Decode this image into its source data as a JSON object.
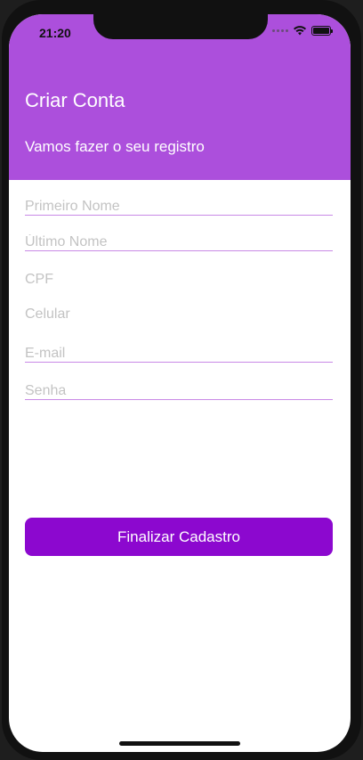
{
  "status_bar": {
    "time": "21:20"
  },
  "header": {
    "title": "Criar Conta",
    "subtitle": "Vamos fazer o seu registro"
  },
  "form": {
    "fields": [
      {
        "placeholder": "Primeiro Nome",
        "value": ""
      },
      {
        "placeholder": "Último Nome",
        "value": ""
      },
      {
        "placeholder": "CPF",
        "value": ""
      },
      {
        "placeholder": "Celular",
        "value": ""
      },
      {
        "placeholder": "E-mail",
        "value": ""
      },
      {
        "placeholder": "Senha",
        "value": ""
      }
    ],
    "submit_label": "Finalizar Cadastro"
  },
  "colors": {
    "header_bg": "#ac4fdc",
    "button_bg": "#8c08cf",
    "underline": "#c98ae6",
    "placeholder": "#c3c3c3"
  }
}
